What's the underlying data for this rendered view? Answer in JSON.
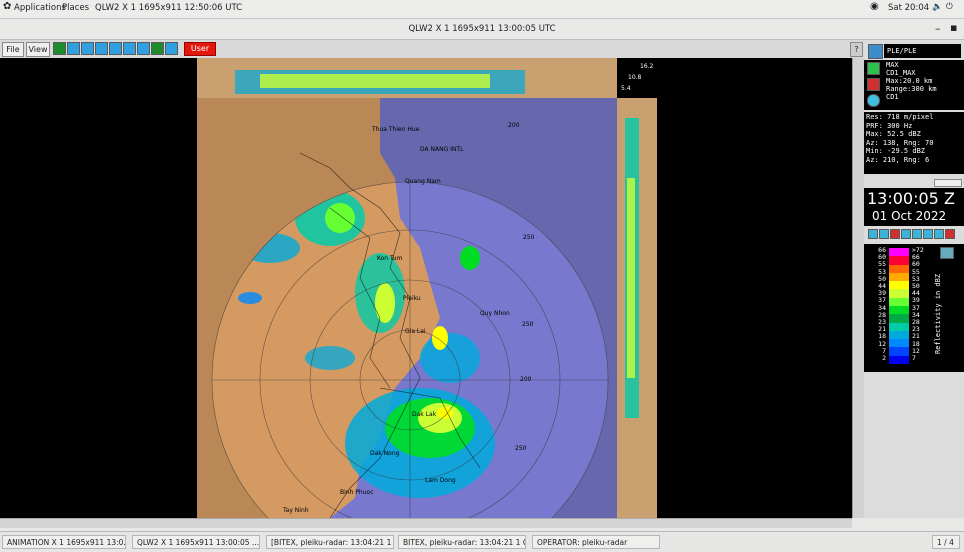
{
  "topbar": {
    "applications": "Applications",
    "places": "Places",
    "window": "QLW2  X 1  1695x911  12:50:06 UTC",
    "clock": "Sat 20:04"
  },
  "window": {
    "title": "QLW2  X 1  1695x911   13:00:05 UTC"
  },
  "toolbar": {
    "file": "File",
    "view": "View",
    "user": "User",
    "help": "?"
  },
  "panel": {
    "site": "PLE/PLE",
    "products": [
      "MAX",
      "CD1_MAX",
      "Max:20.0 km",
      "Range:300 km",
      "CD1"
    ],
    "stats": [
      "Res: 718 m/pixel",
      "PRF: 300 Hz",
      "Max: 52.5 dBZ",
      "Az:  138, Rng: 70",
      "Min: -29.5 dBZ",
      "Az:  210, Rng: 6"
    ],
    "time": "13:00:05 Z",
    "date": "01 Oct 2022",
    "legend_left": [
      "66",
      "60",
      "55",
      "53",
      "50",
      "44",
      "39",
      "37",
      "34",
      "28",
      "23",
      "21",
      "18",
      "12",
      "7",
      "2"
    ],
    "legend_right": [
      ">72",
      "66",
      "60",
      "55",
      "53",
      "50",
      "44",
      "39",
      "37",
      "34",
      "28",
      "23",
      "21",
      "18",
      "12",
      "7"
    ],
    "legend_title": "Reflectivity in dBZ"
  },
  "height_labels": [
    "16.2",
    "10.8",
    "5.4"
  ],
  "range_labels": [
    "200",
    "250",
    "200",
    "250",
    "250"
  ],
  "map_labels": [
    "Thua Thien Hue",
    "DA NANG INTL",
    "Quang Nam",
    "Kon Tum",
    "Pleiku",
    "Gia Lai",
    "Quy Nhon",
    "Dak Lak",
    "Dak Nong",
    "Lam Dong",
    "Binh Phuoc",
    "Tay Ninh"
  ],
  "taskbar": [
    "ANIMATION  X 1  1695x911   13:0...",
    "QLW2  X 1  1695x911   13:00:05 ...",
    "[BITEX, pleiku-radar:  13:04:21  1 O...",
    "BITEX, pleiku-radar:  13:04:21  1 O...",
    "OPERATOR: pleiku-radar",
    "1 / 4"
  ],
  "colors": {
    "ocean": "#7676c6",
    "land": "#d49a62",
    "legend": [
      "#ff00ff",
      "#ff0033",
      "#ff6600",
      "#ffaa00",
      "#ffff00",
      "#ccff33",
      "#66ff33",
      "#00dd22",
      "#00aa44",
      "#00ccaa",
      "#00aadd",
      "#0088ff",
      "#0044ff",
      "#0000ee"
    ]
  }
}
